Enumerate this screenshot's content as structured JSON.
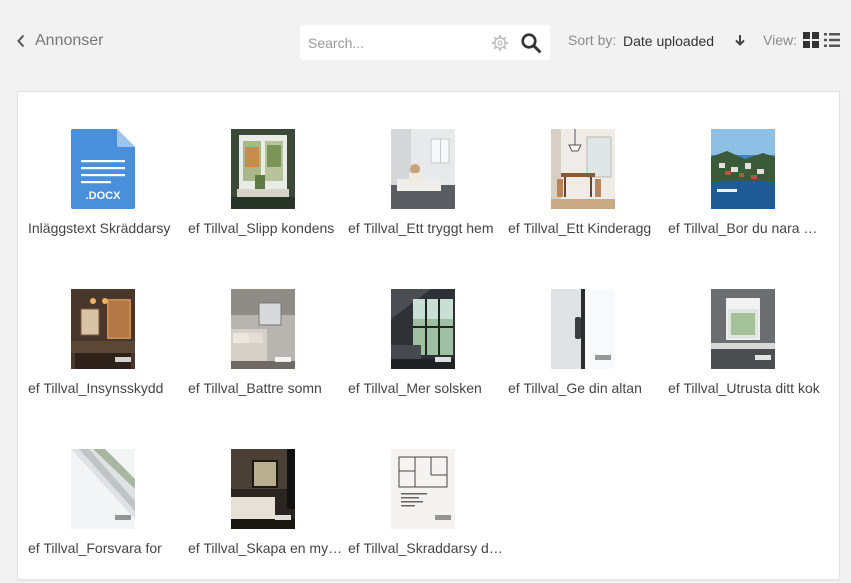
{
  "header": {
    "back_label": "Annonser",
    "search_placeholder": "Search...",
    "sort_label": "Sort by:",
    "sort_value": "Date uploaded",
    "view_label": "View:"
  },
  "files": [
    {
      "name": "Inläggstext Skräddarsy",
      "thumb": "docx-file-icon",
      "badge": ".DOCX"
    },
    {
      "name": "ef Tillval_Slipp kondens",
      "thumb": "window-photo"
    },
    {
      "name": "ef Tillval_Ett tryggt hem",
      "thumb": "bedroom-photo"
    },
    {
      "name": "ef Tillval_Ett Kinderagg",
      "thumb": "dining-photo"
    },
    {
      "name": "ef Tillval_Bor du nara vattnet",
      "thumb": "harbor-photo"
    },
    {
      "name": "ef Tillval_Insynsskydd",
      "thumb": "bathroom-photo"
    },
    {
      "name": "ef Tillval_Battre somn",
      "thumb": "bed-photo"
    },
    {
      "name": "ef Tillval_Mer solsken",
      "thumb": "living-room-photo"
    },
    {
      "name": "ef Tillval_Ge din altan",
      "thumb": "door-handle-photo"
    },
    {
      "name": "ef Tillval_Utrusta ditt kok",
      "thumb": "kitchen-photo"
    },
    {
      "name": "ef Tillval_Forsvara for",
      "thumb": "window-frame-photo"
    },
    {
      "name": "ef Tillval_Skapa en mysig",
      "thumb": "dark-bedroom-photo"
    },
    {
      "name": "ef Tillval_Skraddarsy ditt hem",
      "thumb": "floorplan-image"
    }
  ],
  "colors": {
    "accent": "#4a8fd9",
    "background": "#f2f2f3",
    "panel": "#ffffff"
  }
}
